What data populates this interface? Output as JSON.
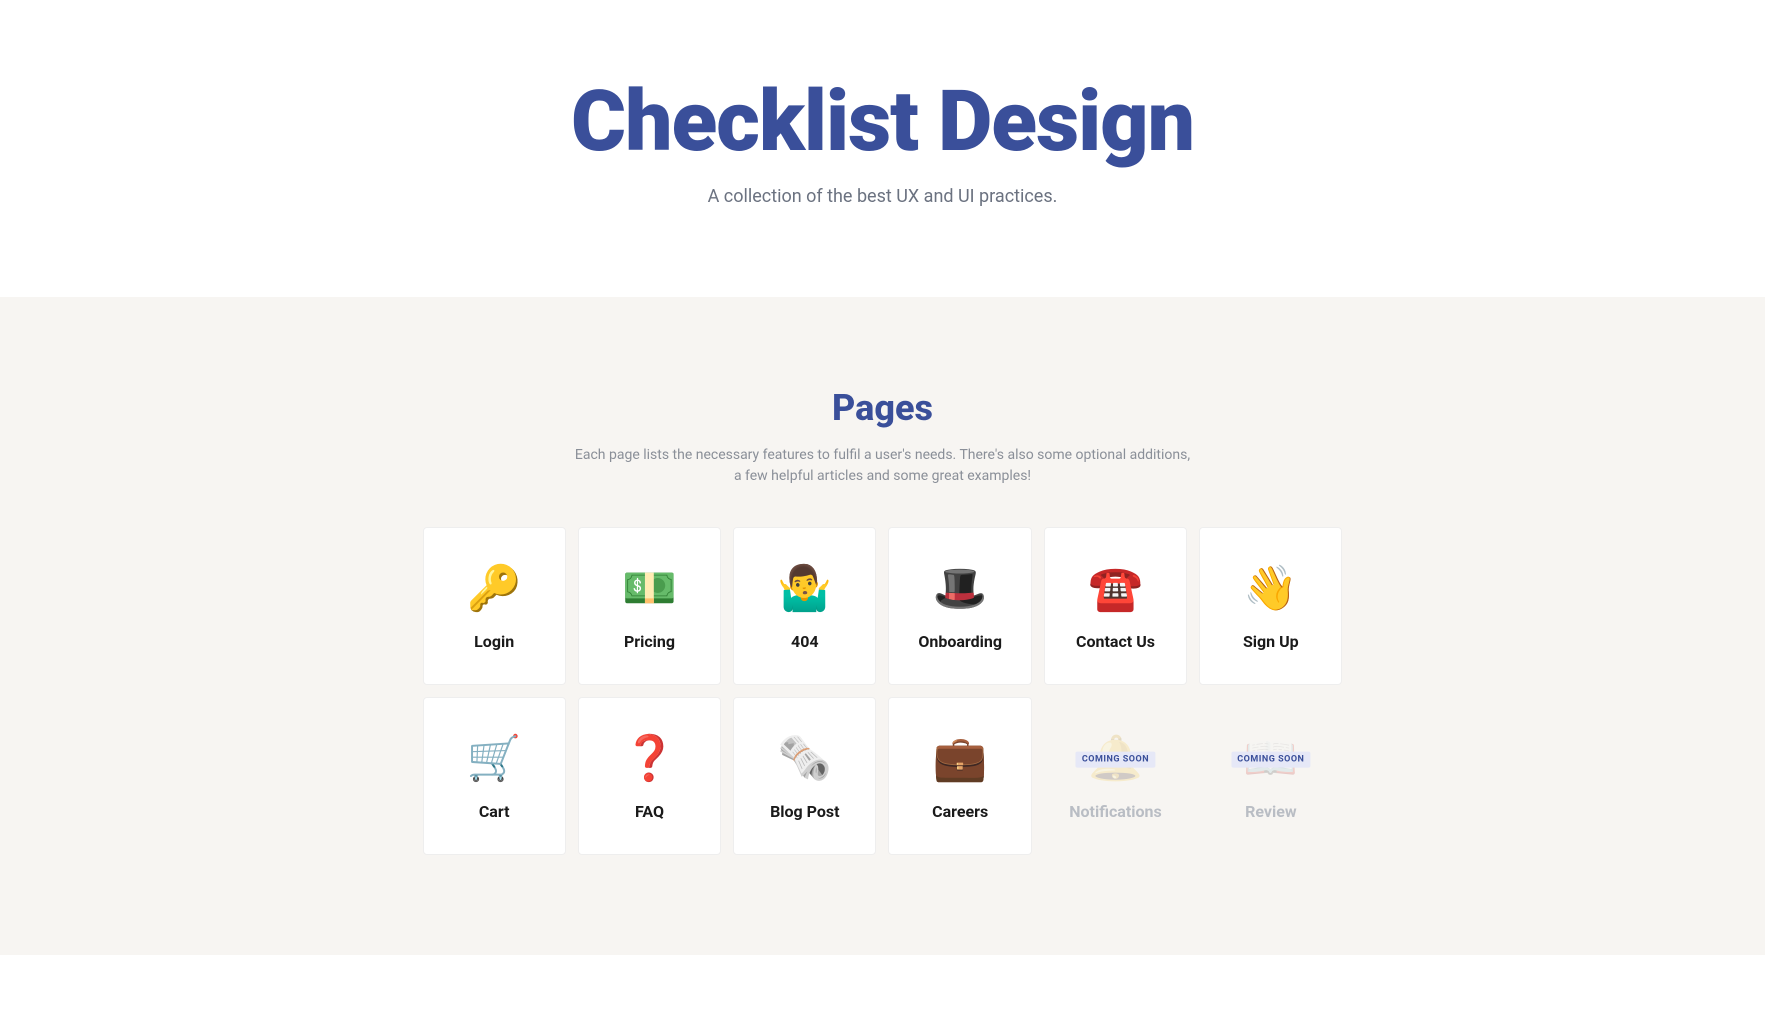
{
  "hero": {
    "title": "Checklist Design",
    "subtitle": "A collection of the best UX and UI practices."
  },
  "section": {
    "heading": "Pages",
    "subheading": "Each page lists the necessary features to fulfil a user's needs. There's also some optional additions, a few helpful articles and some great examples!",
    "coming_soon_label": "COMING SOON",
    "cards": [
      {
        "icon": "🔑",
        "label": "Login",
        "disabled": false
      },
      {
        "icon": "💵",
        "label": "Pricing",
        "disabled": false
      },
      {
        "icon": "🤷‍♂️",
        "label": "404",
        "disabled": false
      },
      {
        "icon": "🎩",
        "label": "Onboarding",
        "disabled": false
      },
      {
        "icon": "☎️",
        "label": "Contact Us",
        "disabled": false
      },
      {
        "icon": "👋",
        "label": "Sign Up",
        "disabled": false
      },
      {
        "icon": "🛒",
        "label": "Cart",
        "disabled": false
      },
      {
        "icon": "❓",
        "label": "FAQ",
        "disabled": false
      },
      {
        "icon": "🗞️",
        "label": "Blog Post",
        "disabled": false
      },
      {
        "icon": "💼",
        "label": "Careers",
        "disabled": false
      },
      {
        "icon": "🔔",
        "label": "Notifications",
        "disabled": true
      },
      {
        "icon": "📖",
        "label": "Review",
        "disabled": true
      }
    ]
  }
}
